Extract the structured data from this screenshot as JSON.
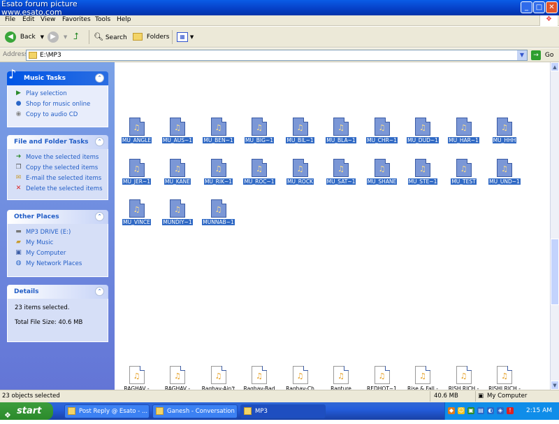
{
  "watermark": {
    "line1": "Esato forum picture",
    "line2": "www.esato.com"
  },
  "window_controls": {
    "minimize": "_",
    "maximize": "□",
    "close": "✕"
  },
  "menu": [
    "File",
    "Edit",
    "View",
    "Favorites",
    "Tools",
    "Help"
  ],
  "toolbar": {
    "back": "Back",
    "search": "Search",
    "folders": "Folders"
  },
  "address": {
    "label": "Address",
    "value": "E:\\MP3",
    "go": "Go"
  },
  "music_tasks": {
    "title": "Music Tasks",
    "items": [
      "Play selection",
      "Shop for music online",
      "Copy to audio CD"
    ]
  },
  "file_tasks": {
    "title": "File and Folder Tasks",
    "items": [
      "Move the selected items",
      "Copy the selected items",
      "E-mail the selected items",
      "Delete the selected items"
    ]
  },
  "other_places": {
    "title": "Other Places",
    "items": [
      "MP3 DRIVE (E:)",
      "My Music",
      "My Computer",
      "My Network Places"
    ]
  },
  "details": {
    "title": "Details",
    "selected": "23 items selected.",
    "total": "Total File Size: 40.6 MB"
  },
  "files_row1": [
    "MU_ANGLE",
    "MU_AUS~1",
    "MU_BEN~1",
    "MU_BIG~1",
    "MU_BIL~1",
    "MU_BLA~1",
    "MU_CHR~1",
    "MU_DUD~1",
    "MU_HAR~1",
    "MU_HHH"
  ],
  "files_row2": [
    "MU_JER~1",
    "MU_KANE",
    "MU_RIK~1",
    "MU_ROC~1",
    "MU_ROCK",
    "MU_SAT~1",
    "MU_SHANE",
    "MU_STE~1",
    "MU_TEST",
    "MU_UND~1"
  ],
  "files_row3": [
    "MU_VINCE",
    "MUNDIY~1",
    "MUNNAB~1"
  ],
  "files_bottom": [
    "RAGHAV -",
    "RAGHAV -",
    "Raghav-Ain't",
    "Raghav-Bad",
    "Raghav-Ch",
    "Rapture",
    "REDHOT~1",
    "Rise & Fall -",
    "RISH RICH -",
    "RISHI RICH -"
  ],
  "status": {
    "left": "23 objects selected",
    "size": "40.6 MB",
    "location": "My Computer"
  },
  "taskbar": {
    "start": "start",
    "tasks": [
      "Post Reply @ Esato - ...",
      "Ganesh - Conversation",
      "MP3"
    ],
    "clock": "2:15 AM"
  }
}
